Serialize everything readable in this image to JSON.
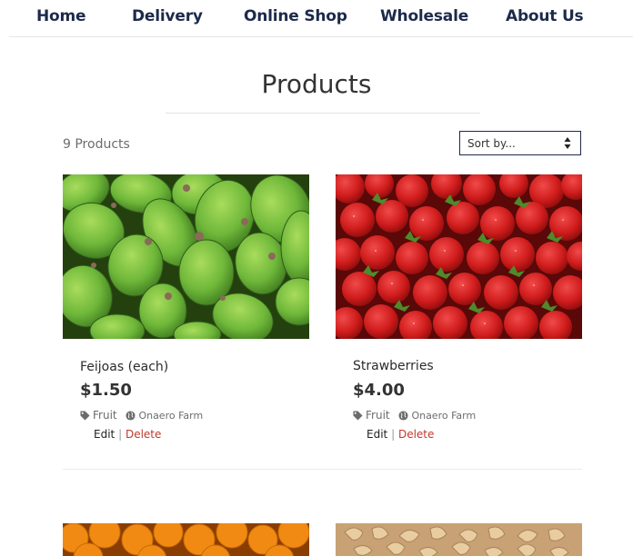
{
  "nav": {
    "items": [
      "Home",
      "Delivery",
      "Online Shop",
      "Wholesale",
      "About Us"
    ]
  },
  "page": {
    "title": "Products",
    "product_count": "9 Products"
  },
  "sort": {
    "label": "Sort by..."
  },
  "products": [
    {
      "name": "Feijoas (each)",
      "price": "$1.50",
      "category": "Fruit",
      "farm": "Onaero Farm",
      "edit_label": "Edit",
      "delete_label": "Delete",
      "image": "feijoas-photo"
    },
    {
      "name": "Strawberries",
      "price": "$4.00",
      "category": "Fruit",
      "farm": "Onaero Farm",
      "edit_label": "Edit",
      "delete_label": "Delete",
      "image": "strawberries-photo"
    },
    {
      "image": "oranges-photo"
    },
    {
      "image": "cashews-photo"
    }
  ],
  "separator": "|",
  "colors": {
    "nav_text": "#1c2a4b",
    "delete_link": "#c0392b",
    "muted_text": "#6c6c6c"
  }
}
